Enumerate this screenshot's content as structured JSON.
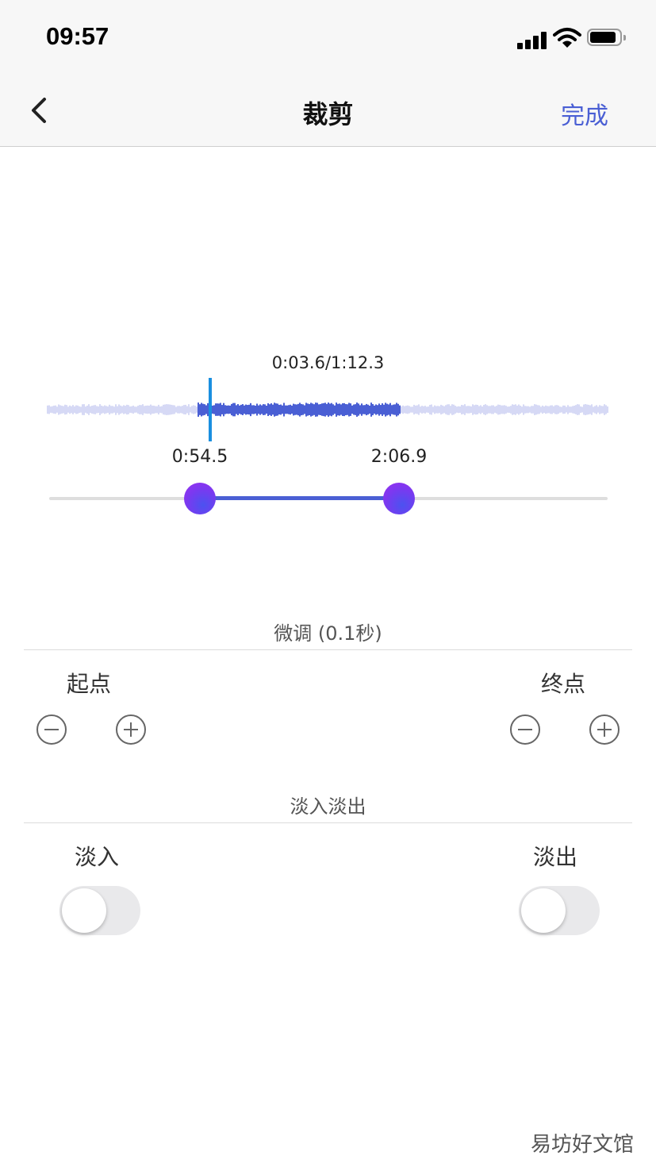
{
  "status_bar": {
    "time": "09:57"
  },
  "nav": {
    "title": "裁剪",
    "done_label": "完成"
  },
  "audio": {
    "time_readout": "0:03.6/1:12.3",
    "start_label": "0:54.5",
    "end_label": "2:06.9"
  },
  "fine_tune": {
    "title": "微调 (0.1秒)",
    "start_label": "起点",
    "end_label": "终点",
    "icons": [
      "minus-circle-icon",
      "plus-circle-icon"
    ]
  },
  "fade": {
    "title": "淡入淡出",
    "fade_in_label": "淡入",
    "fade_out_label": "淡出",
    "fade_in_on": false,
    "fade_out_on": false
  },
  "watermark": "易坊好文馆",
  "colors": {
    "accent": "#4a5fd4",
    "waveform_active": "#4a5fd4",
    "waveform_inactive": "#d6d9f5",
    "playhead": "#1a8fe0",
    "knob": "#7a39f0"
  }
}
